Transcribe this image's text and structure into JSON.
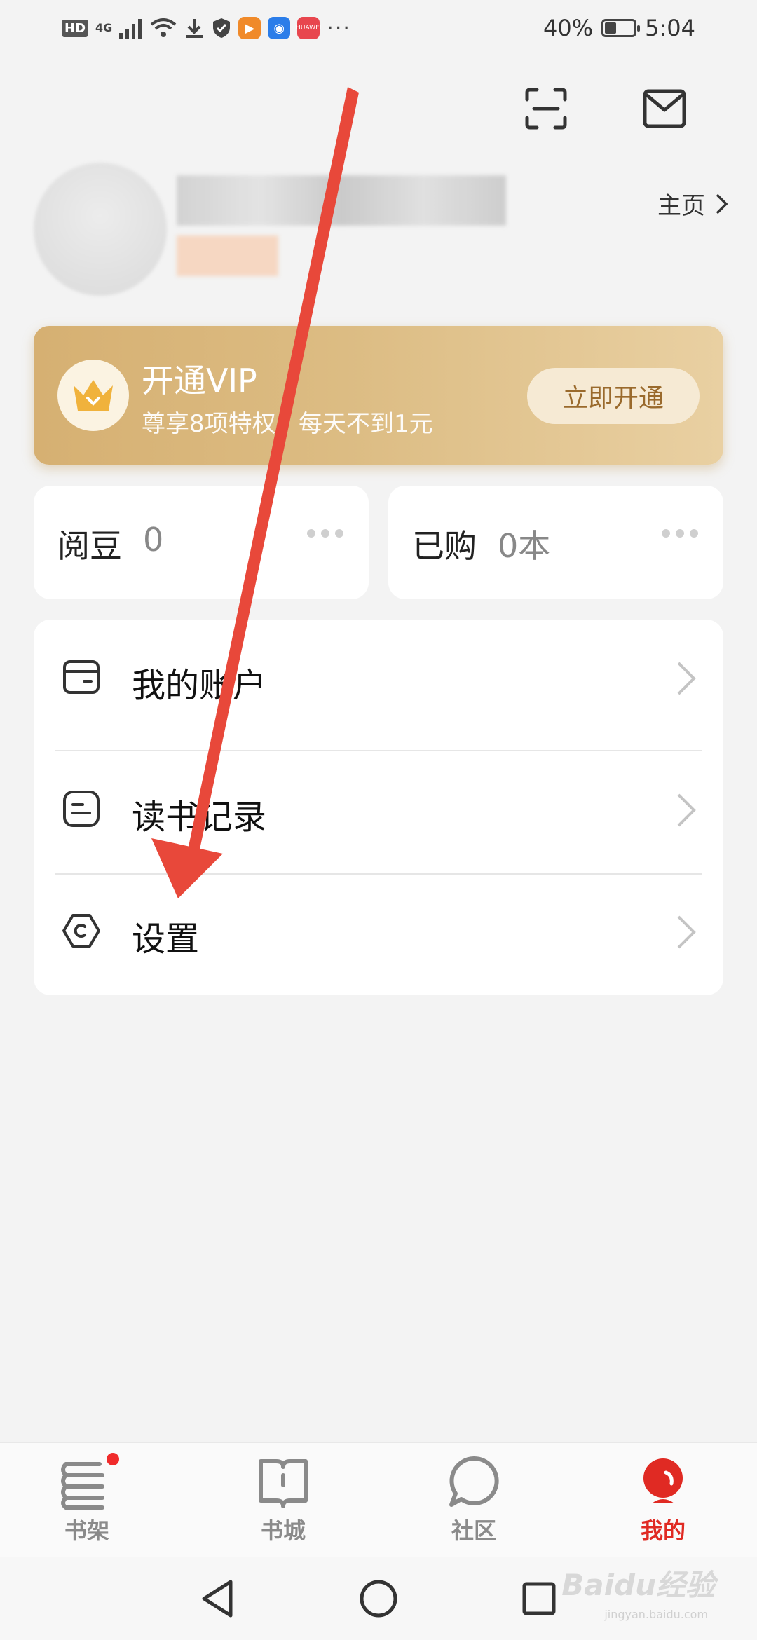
{
  "status_bar": {
    "hd": "HD",
    "network": "4G",
    "battery_percent": "40%",
    "battery_level": 0.4,
    "time": "5:04",
    "more": "···"
  },
  "profile": {
    "home_link": "主页"
  },
  "vip": {
    "title": "开通VIP",
    "subtitle": "尊享8项特权   每天不到1元",
    "button": "立即开通"
  },
  "stats": [
    {
      "label": "阅豆",
      "value": "0"
    },
    {
      "label": "已购",
      "value": "0本"
    }
  ],
  "menu": [
    {
      "label": "我的账户",
      "icon": "wallet-icon"
    },
    {
      "label": "读书记录",
      "icon": "reading-record-icon"
    },
    {
      "label": "设置",
      "icon": "settings-hexagon-icon"
    }
  ],
  "bottom_nav": [
    {
      "label": "书架",
      "icon": "bookshelf-icon",
      "badge": true
    },
    {
      "label": "书城",
      "icon": "bookstore-icon"
    },
    {
      "label": "社区",
      "icon": "community-icon"
    },
    {
      "label": "我的",
      "icon": "profile-icon",
      "active": true
    }
  ],
  "watermark": {
    "text": "Baidu经验",
    "sub": "jingyan.baidu.com"
  },
  "colors": {
    "accent_red": "#e02a23",
    "annotation_arrow": "#e8483a",
    "vip_gold": "#d6b072"
  }
}
